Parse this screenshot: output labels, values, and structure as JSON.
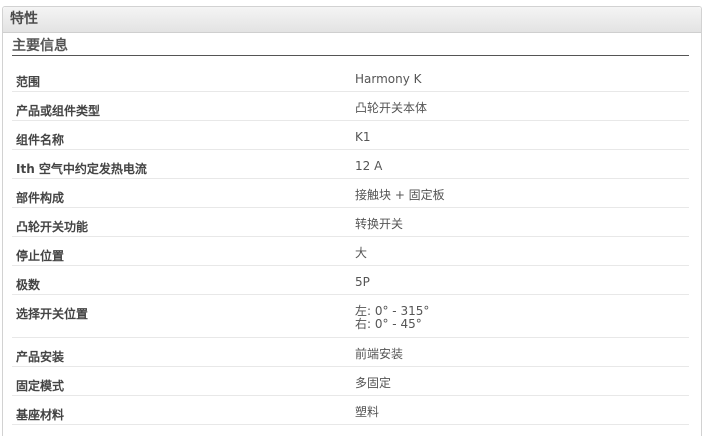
{
  "panel": {
    "title": "特性"
  },
  "section": {
    "title": "主要信息"
  },
  "rows": [
    {
      "label": "范围",
      "value": [
        "Harmony K"
      ]
    },
    {
      "label": "产品或组件类型",
      "value": [
        "凸轮开关本体"
      ]
    },
    {
      "label": "组件名称",
      "value": [
        "K1"
      ]
    },
    {
      "label": "Ith 空气中约定发热电流",
      "value": [
        "12 A"
      ]
    },
    {
      "label": "部件构成",
      "value": [
        "接触块 + 固定板"
      ]
    },
    {
      "label": "凸轮开关功能",
      "value": [
        "转换开关"
      ]
    },
    {
      "label": "停止位置",
      "value": [
        "大"
      ]
    },
    {
      "label": "极数",
      "value": [
        "5P"
      ]
    },
    {
      "label": "选择开关位置",
      "value": [
        "左: 0° - 315°",
        "右: 0° - 45°"
      ]
    },
    {
      "label": "产品安装",
      "value": [
        "前端安装"
      ]
    },
    {
      "label": "固定模式",
      "value": [
        "多固定"
      ]
    },
    {
      "label": "基座材料",
      "value": [
        "塑料"
      ]
    }
  ]
}
